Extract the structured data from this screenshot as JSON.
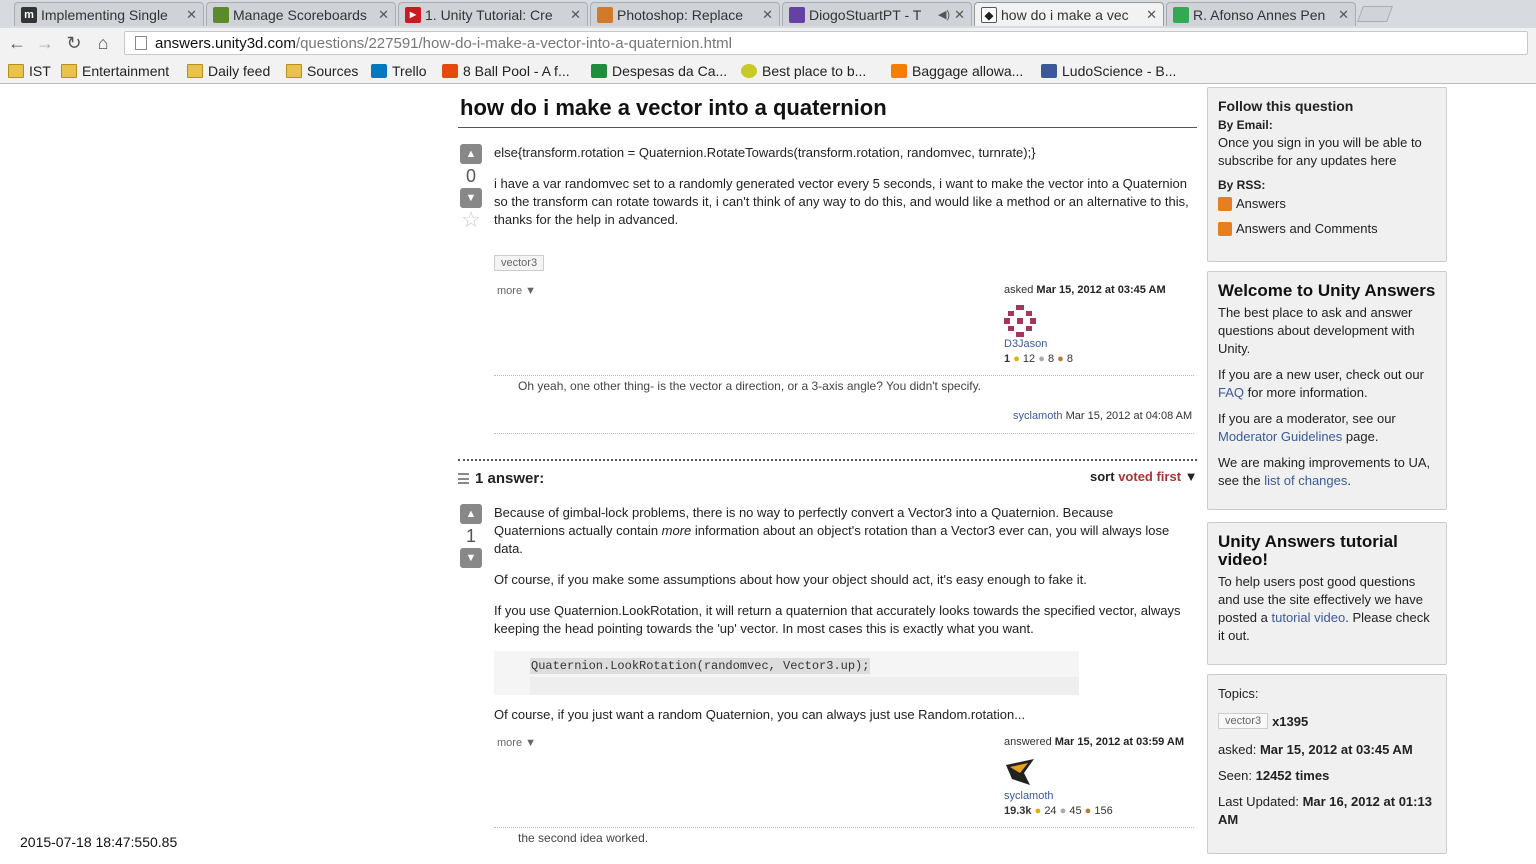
{
  "tabs": [
    {
      "title": "Implementing Single",
      "icon": "m-icon",
      "color": "#333333"
    },
    {
      "title": "Manage Scoreboards",
      "icon": "scoreboard-icon",
      "color": "#5a8a2a"
    },
    {
      "title": "1. Unity Tutorial: Cre",
      "icon": "youtube-icon",
      "color": "#cc181e"
    },
    {
      "title": "Photoshop: Replace",
      "icon": "stackexchange-icon",
      "color": "#d27a2c"
    },
    {
      "title": "DiogoStuartPT - T",
      "icon": "twitch-icon",
      "color": "#6441a5"
    },
    {
      "title": "how do i make a vec",
      "icon": "unity-icon",
      "color": "#222222"
    },
    {
      "title": "R. Afonso Annes Pen",
      "icon": "maps-icon",
      "color": "#34a853"
    }
  ],
  "url": {
    "host": "answers.unity3d.com",
    "path": "/questions/227591/how-do-i-make-a-vector-into-a-quaternion.html"
  },
  "bookmarks": [
    {
      "label": "IST",
      "icon": "folder-icon"
    },
    {
      "label": "Entertainment",
      "icon": "folder-icon"
    },
    {
      "label": "Daily feed",
      "icon": "folder-icon"
    },
    {
      "label": "Sources",
      "icon": "folder-icon"
    },
    {
      "label": "Trello",
      "icon": "trello-icon"
    },
    {
      "label": "8 Ball Pool - A f...",
      "icon": "game-icon"
    },
    {
      "label": "Despesas da Ca...",
      "icon": "sheets-icon"
    },
    {
      "label": "Best place to b...",
      "icon": "smiley-icon"
    },
    {
      "label": "Baggage allowa...",
      "icon": "blogger-icon"
    },
    {
      "label": "LudoScience - B...",
      "icon": "facebook-icon"
    }
  ],
  "question": {
    "title": "how do i make a vector into a quaternion",
    "votes": "0",
    "code_line": "else{transform.rotation = Quaternion.RotateTowards(transform.rotation, randomvec, turnrate);}",
    "body": "i have a var randomvec set to a randomly generated vector every 5 seconds, i want to make the vector into a Quaternion so the transform can rotate towards it, i can't think of any way to do this, and would like a method or an alternative to this, thanks for the help in advanced.",
    "tag": "vector3",
    "more": "more ▼",
    "asked_prefix": "asked",
    "asked_date": "Mar 15, 2012 at 03:45 AM",
    "user": "D3Jason",
    "rep": "1",
    "badges": [
      "12",
      "8",
      "8"
    ],
    "comment": "Oh yeah, one other thing- is the vector a direction, or a 3-axis angle? You didn't specify.",
    "comment_user": "syclamoth",
    "comment_date": "Mar 15, 2012 at 04:08 AM"
  },
  "answers_header": {
    "count_label": "1 answer:",
    "sort_prefix": "sort",
    "sort_value": "voted first",
    "sort_arrow": "▼"
  },
  "answer": {
    "votes": "1",
    "p1_a": "Because of gimbal-lock problems, there is no way to perfectly convert a Vector3 into a Quaternion. Because Quaternions actually contain ",
    "p1_em": "more",
    "p1_b": " information about an object's rotation than a Vector3 ever can, you will always lose data.",
    "p2": "Of course, if you make some assumptions about how your object should act, it's easy enough to fake it.",
    "p3": "If you use Quaternion.LookRotation, it will return a quaternion that accurately looks towards the specified vector, always keeping the head pointing towards the 'up' vector. In most cases this is exactly what you want.",
    "code": "Quaternion.LookRotation(randomvec, Vector3.up);",
    "p4": "Of course, if you just want a random Quaternion, you can always just use Random.rotation...",
    "more": "more ▼",
    "answered_prefix": "answered",
    "answered_date": "Mar 15, 2012 at 03:59 AM",
    "user": "syclamoth",
    "rep": "19.3k",
    "badges": [
      "24",
      "45",
      "156"
    ],
    "comment": "the second idea worked."
  },
  "sidebar": {
    "follow": {
      "title": "Follow this question",
      "by_email": "By Email:",
      "email_text": "Once you sign in you will be able to subscribe for any updates here",
      "by_rss": "By RSS:",
      "rss1": "Answers",
      "rss2": "Answers and Comments"
    },
    "welcome": {
      "title": "Welcome to Unity Answers",
      "p1": "The best place to ask and answer questions about development with Unity.",
      "p2_a": "If you are a new user, check out our ",
      "p2_link": "FAQ",
      "p2_b": " for more information.",
      "p3_a": "If you are a moderator, see our ",
      "p3_link": "Moderator Guidelines",
      "p3_b": " page.",
      "p4_a": "We are making improvements to UA, see the ",
      "p4_link": "list of changes",
      "p4_b": "."
    },
    "tutorial": {
      "title": "Unity Answers tutorial video!",
      "p_a": "To help users post good questions and use the site effectively we have posted a ",
      "p_link": "tutorial video",
      "p_b": ". Please check it out."
    },
    "stats": {
      "topics_label": "Topics:",
      "tag": "vector3",
      "tag_count": "x1395",
      "asked_label": "asked:",
      "asked_value": "Mar 15, 2012 at 03:45 AM",
      "seen_label": "Seen:",
      "seen_value": "12452 times",
      "updated_label": "Last Updated:",
      "updated_value": "Mar 16, 2012 at 01:13 AM"
    }
  },
  "timestamp": "2015-07-18 18:47:550.85"
}
